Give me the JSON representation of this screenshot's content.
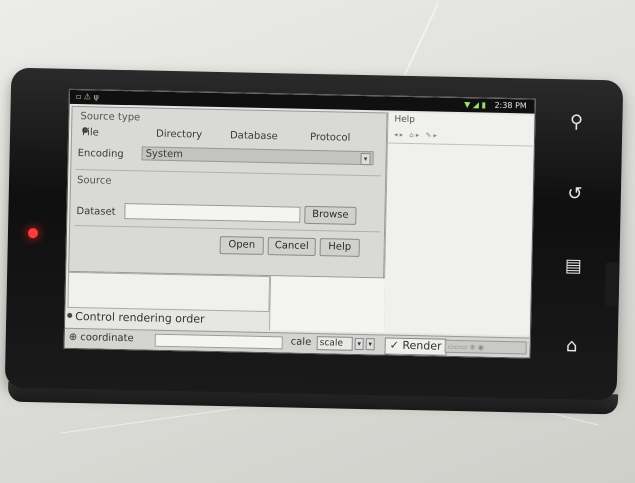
{
  "phone": {
    "status_time": "2:38 PM"
  },
  "dialog": {
    "source_type_title": "Source type",
    "radio_options": [
      "File",
      "Directory",
      "Database",
      "Protocol"
    ],
    "encoding_label": "Encoding",
    "encoding_value": "System",
    "source_title": "Source",
    "dataset_label": "Dataset",
    "browse_label": "Browse",
    "open_label": "Open",
    "cancel_label": "Cancel",
    "help_label": "Help"
  },
  "help_pane": {
    "title": "Help"
  },
  "control_rendering_label": "Control rendering order",
  "bottom_bar": {
    "coordinate_label": "coordinate",
    "scale_label_prefix": "cale",
    "scale_value": "scale",
    "render_label": "Render"
  },
  "nav_keys": [
    "search-icon",
    "back-icon",
    "menu-icon",
    "home-icon"
  ]
}
